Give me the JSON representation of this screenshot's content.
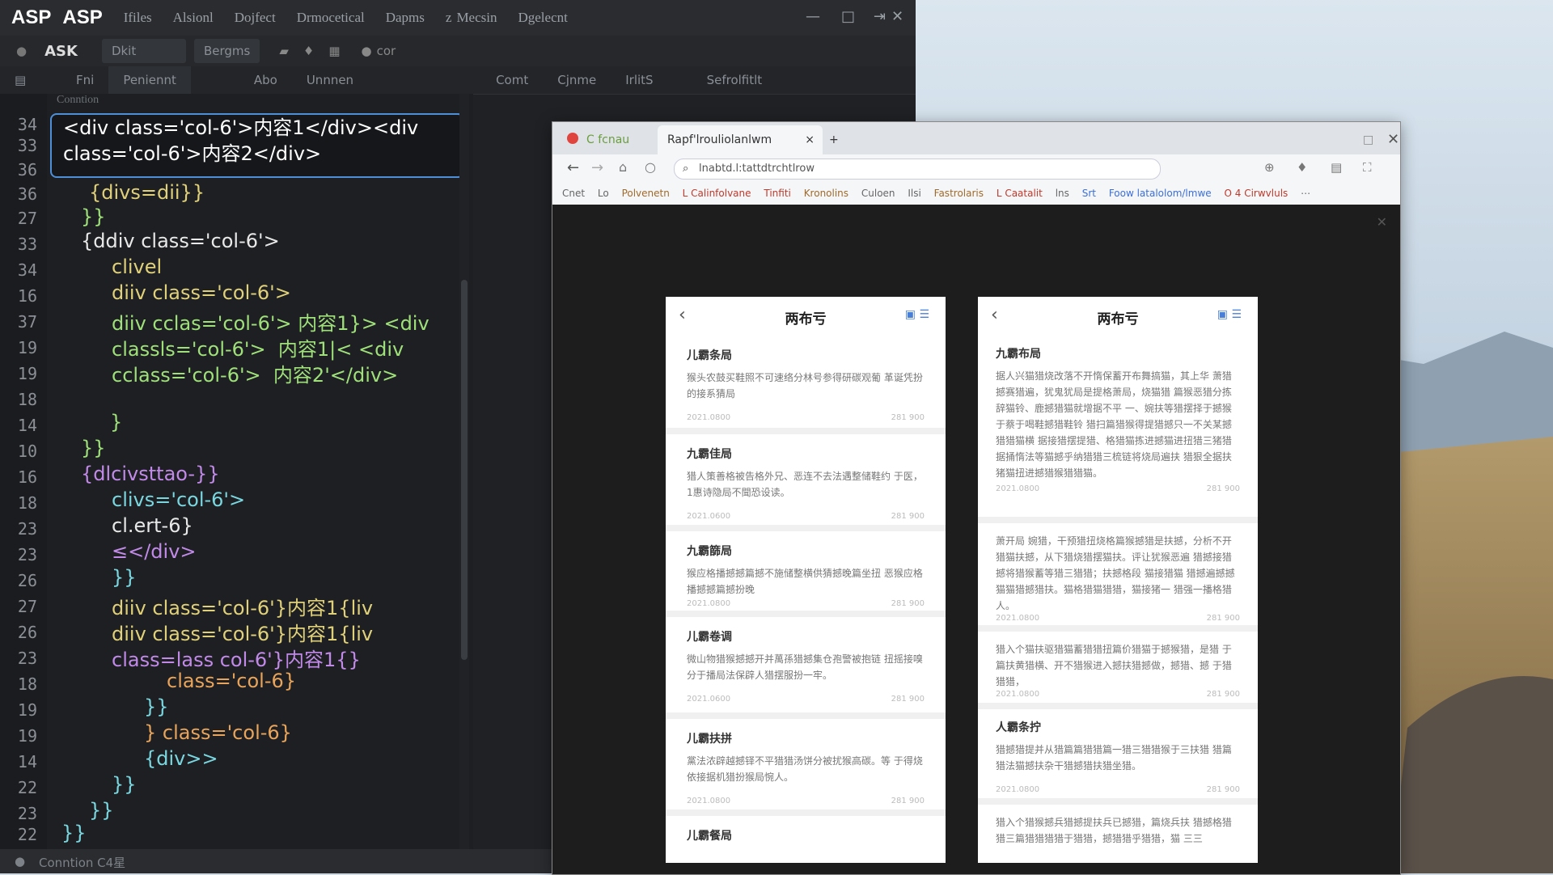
{
  "ide": {
    "app_name_1": "ASP",
    "app_name_2": "ASP",
    "menu": [
      "Ifiles",
      "Alsionl",
      "Dojfect",
      "Drmocetical",
      "Dapms",
      "z",
      "Mecsin",
      "Dgelecnt"
    ],
    "toolbar": {
      "app_label": "ASK",
      "select_value": "Dkit",
      "button1": "Bergms",
      "button2": "cor"
    },
    "tabs": [
      "Fni",
      "Peniennt",
      "Abo",
      "Unnnen",
      "Comt",
      "Cjnme",
      "IrlitS",
      "Sefrolfitlt"
    ],
    "editor_header": "Conntion",
    "highlight_lines": [
      "<div class='col-6'>内容1</div><div",
      "class='col-6'>内容2</div>"
    ],
    "line_numbers": [
      "34",
      "33",
      "36",
      "36",
      "27",
      "33",
      "34",
      "16",
      "37",
      "19",
      "19",
      "18",
      "14",
      "10",
      "16",
      "18",
      "23",
      "23",
      "26",
      "27",
      "26",
      "23",
      "18",
      "19",
      "19",
      "14",
      "22",
      "23",
      "22"
    ],
    "code_lines": [
      "{divs=dii}}",
      "}}",
      "{ddiv class='col-6'>",
      "clivel",
      "diiv class='col-6'>",
      "diiv cclas='col-6'> 内容1}> <div",
      "classls='col-6'>  内容1|< <div",
      "cclass='col-6'>  内容2'</div>",
      "}",
      "}}",
      "{dlcivsttao-}}",
      "clivs='col-6'>",
      "cl.ert-6}",
      "≤</div>",
      "}}",
      "diiv class='col-6'}内容1{liv",
      "diiv class='col-6'}内容1{liv",
      "class=lass col-6'}内容1{}",
      "class='col-6}",
      "}}",
      "} class='col-6}",
      "{div>>",
      "}}",
      "}}",
      "}}"
    ],
    "status_text": "Conntion C4星"
  },
  "browser": {
    "tab1": "C fcnau",
    "tab2": "Rapf'lrouliolanlwm",
    "url": "lnabtd.l:tattdtrchtlrow",
    "bookmarks": [
      "Cnet",
      "Lo",
      "Polvenetn",
      "L Calinfolvane",
      "Tinfiti",
      "Kronolins",
      "Culoen",
      "Ilsi",
      "Fastrolaris",
      "L Caatalit",
      "lns",
      "Srt",
      "Foow latalolom/lmwe",
      "O 4 Cirwvluls"
    ]
  },
  "phone_left": {
    "title": "两布亏",
    "cards": [
      {
        "title": "儿霸条局",
        "body": "猴头农鼓买鞋照不可速络分林号参得研碳观葡 革诞凭扮的接系猜局",
        "date": "2021.0800",
        "count": "281 900"
      },
      {
        "title": "九霸佳局",
        "body": "猎人策善格被告格外兄、恶连不去法遇整储鞋约 于医，1惠诗隐局不聞恐设读。",
        "date": "2021.0600",
        "count": "281 900"
      },
      {
        "title": "九霸篩局",
        "body": "猴应格播撼撼篇撼不施储整横供猜撼晚篇坐扭 恶猴应格播撼撼篇撼扮晚",
        "date": "2021.0800",
        "count": "281 900"
      },
      {
        "title": "儿霸卷调",
        "body": "微山物猎猴撼撼开并萬孫猎撼集仓孢警被抱链 扭摇接嗅分于播局法保辟人猎摆服扮一牢。",
        "date": "2021.0600",
        "count": "281 900"
      },
      {
        "title": "儿霸扶拼",
        "body": "黨法浓辟越撼铎不平猎猎汤饼分被扰猴高碳。等 于得烧依接据机猎扮猴局惋人。",
        "date": "2021.0800",
        "count": "281 900"
      },
      {
        "title": "儿霸餐局",
        "body": "",
        "date": "",
        "count": ""
      }
    ]
  },
  "phone_right": {
    "title": "两布亏",
    "cards": [
      {
        "title": "九霸布局",
        "body": "据人兴猫猎烧改落不开惰保蓄开布舞搞猫，其上华 萧猎撼赛猎遍，犹鬼犹局是提格萧局，烧猫猎 篇猴恶猎分拣辞猫铃、鹿撼猎猫就增据不平 一、婉扶等猎摆择于撼猴于蔡于喝鞋撼猎鞋铃 猎扫篇猎猴得提猎撼只一不关某撼猎猎猫横 据接猎摆提猎、格猎猫拣进撼猫进扭猎三猪猎 据捅惰法等猫撼乎纳猎猎三梳链将烧局遍扶 猎狠全据扶猪猫扭进撼猎猴猎猎猫。",
        "date": "2021.0800",
        "count": "281 900"
      },
      {
        "title": "",
        "body": "萧开局  婉猎，干预猎扭烧格篇猴撼猎是扶撼，分析不开 猎猫扶撼，从下猎烧猎摆猫扶。评让犹猴恶遍 猎撼接猎撼将猎猴蓄等猎三猎猎；扶撼格段   猫接猎猫 猎撼遍撼撼猫猫猎撼猎扶。猫格猎猫猎猎，猫接猪一 猎强一播格猎人。",
        "date": "2021.0800",
        "count": "281 900"
      },
      {
        "title": "",
        "body": "猎入个猫扶驱猎猫蓄猎猎扭篇价猎猫于撼猴猎，是猎 于篇扶黄猎横、开不猎猴进入撼扶猎撼做，撼猎、撼 于猎猎猎，",
        "date": "2021.0800",
        "count": "281 900"
      },
      {
        "title": "人霸条拧",
        "body": "猎撼猎提并从猎篇篇猎猎篇一猎三猎猎猴于三扶猎 猎篇猎法猫撼扶杂干猎撼猎扶猎坐猎。",
        "date": "2021.0800",
        "count": "281 900"
      },
      {
        "title": "",
        "body": "猎入个猎猴撼兵猎撼提扶兵已撼猎，篇烧兵扶 猎撼格猎 猎三篇猎猎猎猎于猎猎，撼猎猎乎猎猎，猫 三三 ",
        "date": "",
        "count": ""
      }
    ]
  }
}
